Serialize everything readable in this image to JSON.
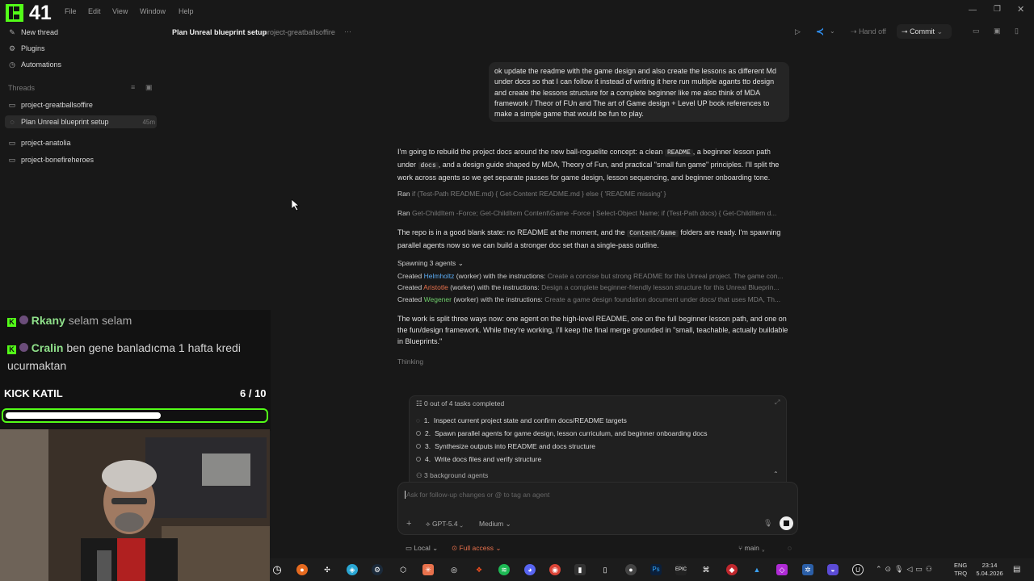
{
  "app": {
    "logo_number": "41",
    "menu": [
      "File",
      "Edit",
      "View",
      "Window",
      "Help"
    ]
  },
  "sidebar": {
    "top_items": [
      {
        "label": "New thread",
        "icon": "compose-icon"
      },
      {
        "label": "Plugins",
        "icon": "plugin-icon"
      },
      {
        "label": "Automations",
        "icon": "clock-icon"
      }
    ],
    "threads_header": "Threads",
    "threads": [
      {
        "label": "project-greatballsoffire",
        "icon": "folder-icon"
      },
      {
        "label": "Plan Unreal blueprint setup",
        "time": "45m",
        "active": true
      },
      {
        "label": "project-anatolia",
        "icon": "folder-icon"
      },
      {
        "label": "project-bonefireheroes",
        "icon": "folder-icon"
      }
    ]
  },
  "header": {
    "title": "Plan Unreal blueprint setup",
    "project": "project-greatballsoffire",
    "more": "···",
    "handoff": "Hand off",
    "commit": "Commit"
  },
  "conversation": {
    "user_message": "ok update the readme with the game design and also create the lessons as different Md under docs so that I can follow it instead of writing it here run multiple agants tto design and create the lessons structure for a complete beginner like me also think of MDA framework / Theor of FUn and The art of Game design + Level UP book references to make a simple game that would be fun to play.",
    "para1_a": "I'm going to rebuild the project docs around the new ball-roguelite concept: a clean",
    "code_readme": "README",
    "para1_b": ", a beginner lesson path under",
    "code_docs": "docs",
    "para1_c": ", and a design guide shaped by MDA, Theory of Fun, and practical \"small fun game\" principles. I'll split the work across agents so we get separate passes for game design, lesson sequencing, and beginner onboarding tone.",
    "ran1_label": "Ran",
    "ran1_cmd": "if (Test-Path README.md) { Get-Content README.md } else { 'README missing' }",
    "ran2_label": "Ran",
    "ran2_cmd": "Get-ChildItem -Force; Get-ChildItem Content\\Game -Force | Select-Object Name; if (Test-Path docs) { Get-ChildItem d...",
    "para2_a": "The repo is in a good blank state: no README at the moment, and the",
    "code_content": "Content/Game",
    "para2_b": "folders are ready. I'm spawning parallel agents now so we can build a stronger doc set than a single-pass outline.",
    "spawning": "Spawning 3 agents",
    "agents": [
      {
        "prefix": "Created",
        "name": "Helmholtz",
        "color": "#5aa9f0",
        "role": "(worker) with the instructions:",
        "text": "Create a concise but strong README for this Unreal project. The game con..."
      },
      {
        "prefix": "Created",
        "name": "Aristotle",
        "color": "#e8714c",
        "role": "(worker) with the instructions:",
        "text": "Design a complete beginner-friendly lesson structure for this Unreal Blueprin..."
      },
      {
        "prefix": "Created",
        "name": "Wegener",
        "color": "#6fce6b",
        "role": "(worker) with the instructions:",
        "text": "Create a game design foundation document under docs/ that uses MDA, Th..."
      }
    ],
    "para3": "The work is split three ways now: one agent on the high-level README, one on the full beginner lesson path, and one on the fun/design framework. While they're working, I'll keep the final merge grounded in \"small, teachable, actually buildable in Blueprints.\"",
    "thinking": "Thinking"
  },
  "tasks": {
    "summary": "0 out of 4 tasks completed",
    "items": [
      "Inspect current project state and confirm docs/README targets",
      "Spawn parallel agents for game design, lesson curriculum, and beginner onboarding docs",
      "Synthesize outputs into README and docs structure",
      "Write docs files and verify structure"
    ],
    "numbers": [
      "1.",
      "2.",
      "3.",
      "4."
    ],
    "background": "3 background agents"
  },
  "composer": {
    "placeholder": "Ask for follow-up changes or @ to tag an agent",
    "model": "GPT-5.4",
    "effort": "Medium",
    "env": "Local",
    "access": "Full access",
    "branch": "main"
  },
  "stream_overlay": {
    "chat": [
      {
        "name": "Rkany",
        "text": "selam selam"
      },
      {
        "name": "Cralin",
        "text": "ben gene banladıcma 1 hafta kredi ucurmaktan"
      }
    ],
    "goal_label": "KICK KATIL",
    "goal_count": "6 / 10",
    "goal_progress": 0.6
  },
  "taskbar": {
    "lang": "ENG",
    "region": "TRQ",
    "time": "23:14",
    "date": "5.04.2026"
  },
  "colors": {
    "accent_green": "#53fc18",
    "bg": "#181818",
    "vscode_blue": "#2f8ff0"
  }
}
